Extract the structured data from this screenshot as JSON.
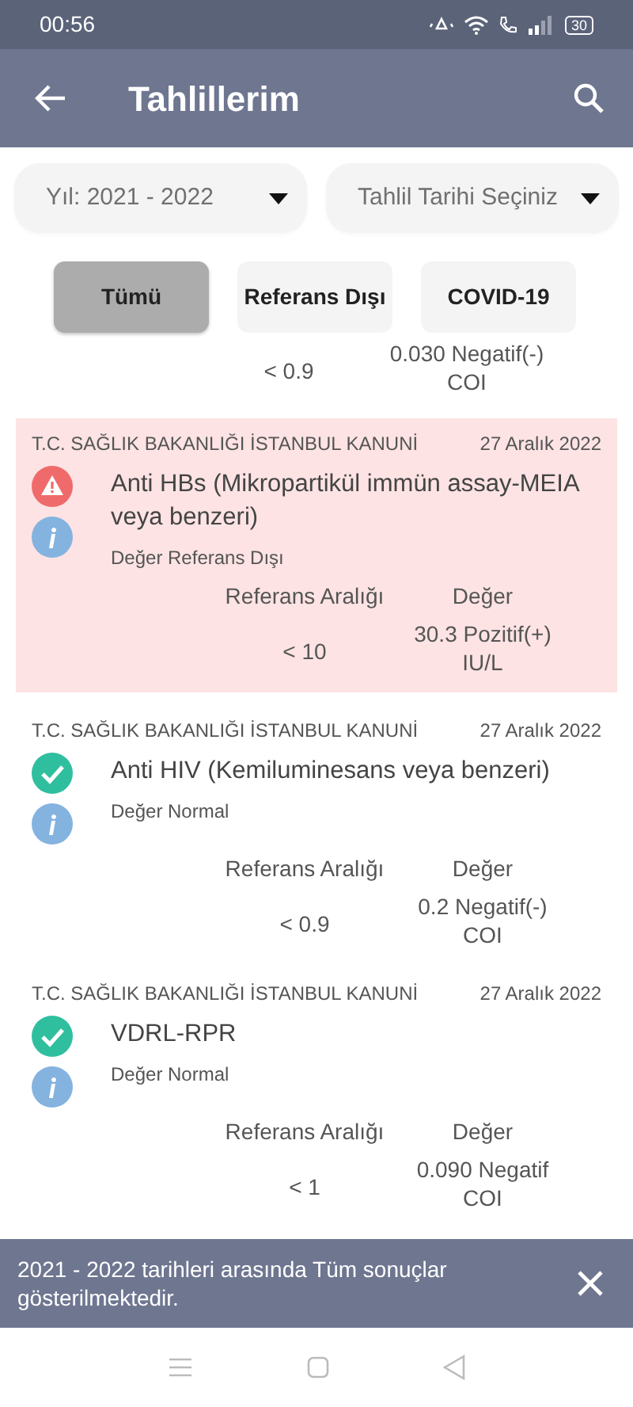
{
  "status_bar": {
    "time": "00:56",
    "battery": "30"
  },
  "app_bar": {
    "title": "Tahlillerim"
  },
  "filters": [
    {
      "label": "Yıl: 2021 - 2022"
    },
    {
      "label": "Tahlil Tarihi Seçiniz"
    }
  ],
  "chips": [
    {
      "label": "Tümü",
      "selected": true
    },
    {
      "label": "Referans Dışı",
      "selected": false
    },
    {
      "label": "COVID-19",
      "selected": false
    }
  ],
  "partial_row": {
    "range": "< 0.9",
    "value": "0.030 Negatif(-) COI"
  },
  "results": [
    {
      "institution": "T.C. SAĞLIK BAKANLIĞI İSTANBUL KANUNİ",
      "date": "27 Aralık 2022",
      "name": "Anti HBs (Mikropartikül immün assay-MEIA veya benzeri)",
      "kind": "warning",
      "status_text": "Değer Referans Dışı",
      "range_header": "Referans Aralığı",
      "value_header": "Değer",
      "range": "< 10",
      "value": "30.3 Pozitif(+) IU/L"
    },
    {
      "institution": "T.C. SAĞLIK BAKANLIĞI İSTANBUL KANUNİ",
      "date": "27 Aralık 2022",
      "name": "Anti HIV (Kemiluminesans veya benzeri)",
      "kind": "normal",
      "status_text": "Değer Normal",
      "range_header": "Referans Aralığı",
      "value_header": "Değer",
      "range": "< 0.9",
      "value": "0.2 Negatif(-) COI"
    },
    {
      "institution": "T.C. SAĞLIK BAKANLIĞI İSTANBUL KANUNİ",
      "date": "27 Aralık 2022",
      "name": "VDRL-RPR",
      "kind": "normal",
      "status_text": "Değer Normal",
      "range_header": "Referans Aralığı",
      "value_header": "Değer",
      "range": "< 1",
      "value": "0.090 Negatif COI"
    }
  ],
  "snackbar": {
    "message": "2021 - 2022 tarihleri arasında Tüm sonuçlar gösterilmektedir."
  }
}
